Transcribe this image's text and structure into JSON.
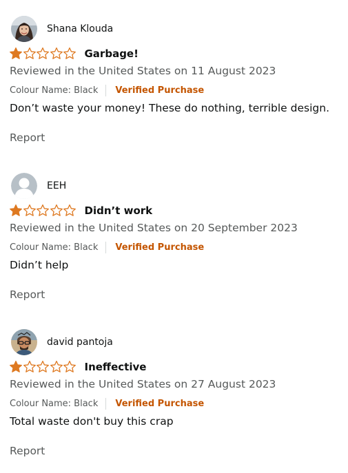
{
  "reviews": [
    {
      "reviewer": "Shana Klouda",
      "avatar": "photo-avatar-woman",
      "rating": 1,
      "rating_max": 5,
      "title": "Garbage!",
      "date": "Reviewed in the United States on 11 August 2023",
      "variant": "Colour Name: Black",
      "verified": "Verified Purchase",
      "body": "Don’t waste your money! These do nothing, terrible design.",
      "report": "Report"
    },
    {
      "reviewer": "EEH",
      "avatar": "default-avatar",
      "rating": 1,
      "rating_max": 5,
      "title": "Didn’t work",
      "date": "Reviewed in the United States on 20 September 2023",
      "variant": "Colour Name: Black",
      "verified": "Verified Purchase",
      "body": "Didn’t help",
      "report": "Report"
    },
    {
      "reviewer": "david pantoja",
      "avatar": "illustrated-avatar",
      "rating": 1,
      "rating_max": 5,
      "title": "Ineffective",
      "date": "Reviewed in the United States on 27 August 2023",
      "variant": "Colour Name: Black",
      "verified": "Verified Purchase",
      "body": "Total waste don't buy this crap",
      "report": "Report"
    }
  ],
  "colors": {
    "star": "#de7921",
    "verified": "#c45500",
    "secondary_text": "#565959",
    "primary_text": "#0f1111"
  }
}
